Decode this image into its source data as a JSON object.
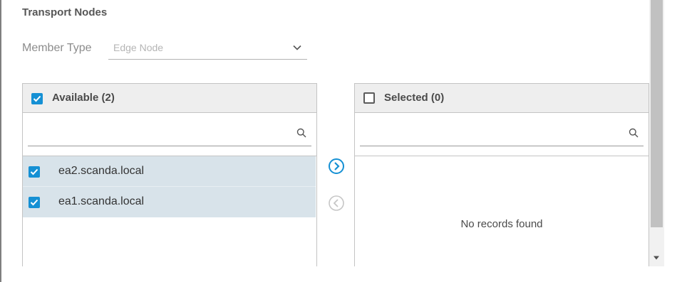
{
  "section": {
    "title": "Transport Nodes"
  },
  "member_type": {
    "label": "Member Type",
    "selected_value": "Edge Node",
    "icon": "chevron-down-icon"
  },
  "available": {
    "title": "Available (2)",
    "all_checked": true,
    "search_value": "",
    "items": [
      {
        "label": "ea2.scanda.local",
        "checked": true
      },
      {
        "label": "ea1.scanda.local",
        "checked": true
      }
    ]
  },
  "selected": {
    "title": "Selected (0)",
    "all_checked": false,
    "search_value": "",
    "empty_text": "No records found"
  },
  "actions": {
    "move_right_icon": "chevron-right-circle-icon",
    "move_left_icon": "chevron-left-circle-icon"
  },
  "colors": {
    "accent": "#1590d4",
    "row_selected_bg": "#d8e3ea",
    "header_bg": "#eeeeee",
    "disabled": "#b5b5b5"
  }
}
